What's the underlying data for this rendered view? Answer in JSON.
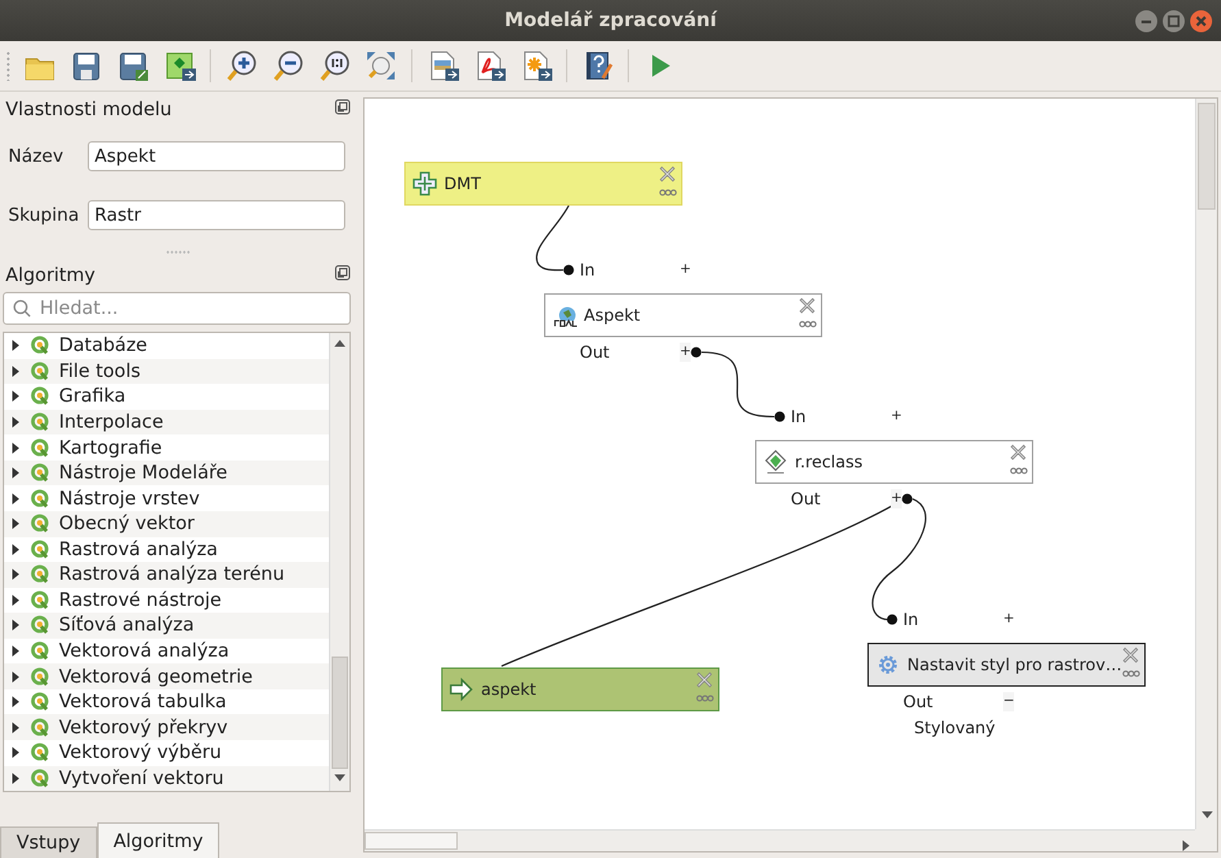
{
  "window": {
    "title": "Modelář zpracování"
  },
  "model_properties": {
    "title": "Vlastnosti modelu",
    "fields": [
      {
        "label": "Název",
        "value": "Aspekt"
      },
      {
        "label": "Skupina",
        "value": "Rastr"
      }
    ]
  },
  "algorithms": {
    "title": "Algoritmy",
    "search": {
      "placeholder": "Hledat..."
    },
    "items": [
      {
        "label": "Databáze",
        "expanded": false
      },
      {
        "label": "File tools",
        "expanded": false
      },
      {
        "label": "Grafika",
        "expanded": false
      },
      {
        "label": "Interpolace",
        "expanded": false
      },
      {
        "label": "Kartografie",
        "expanded": false
      },
      {
        "label": "Nástroje Modeláře",
        "expanded": false
      },
      {
        "label": "Nástroje vrstev",
        "expanded": false
      },
      {
        "label": "Obecný vektor",
        "expanded": false
      },
      {
        "label": "Rastrová analýza",
        "expanded": false
      },
      {
        "label": "Rastrová analýza terénu",
        "expanded": false
      },
      {
        "label": "Rastrové nástroje",
        "expanded": false
      },
      {
        "label": "Síťová analýza",
        "expanded": false
      },
      {
        "label": "Vektorová analýza",
        "expanded": false
      },
      {
        "label": "Vektorová geometrie",
        "expanded": false
      },
      {
        "label": "Vektorová tabulka",
        "expanded": false
      },
      {
        "label": "Vektorový překryv",
        "expanded": false
      },
      {
        "label": "Vektorový výběru",
        "expanded": false
      },
      {
        "label": "Vytvoření vektoru",
        "expanded": false
      }
    ]
  },
  "tabs": [
    {
      "label": "Vstupy",
      "selected": false
    },
    {
      "label": "Algoritmy",
      "selected": true
    }
  ],
  "canvas": {
    "nodes": [
      {
        "kind": "input",
        "title": "DMT",
        "selected": false
      },
      {
        "kind": "algorithm",
        "title": "Aspekt",
        "selected": false,
        "inputs": [
          {
            "label": "In",
            "toggle": "+"
          }
        ],
        "outputs": [
          {
            "label": "Out",
            "toggle": "+"
          }
        ]
      },
      {
        "kind": "algorithm",
        "title": "r.reclass",
        "selected": false,
        "inputs": [
          {
            "label": "In",
            "toggle": "+"
          }
        ],
        "outputs": [
          {
            "label": "Out",
            "toggle": "+"
          }
        ]
      },
      {
        "kind": "algorithm",
        "title": "Nastavit styl pro rastrov…",
        "selected": true,
        "inputs": [
          {
            "label": "In",
            "toggle": "+"
          }
        ],
        "outputs": [
          {
            "label": "Out",
            "toggle": "−",
            "items": [
              "Stylovaný"
            ]
          }
        ]
      },
      {
        "kind": "output",
        "title": "aspekt",
        "selected": false
      }
    ]
  }
}
